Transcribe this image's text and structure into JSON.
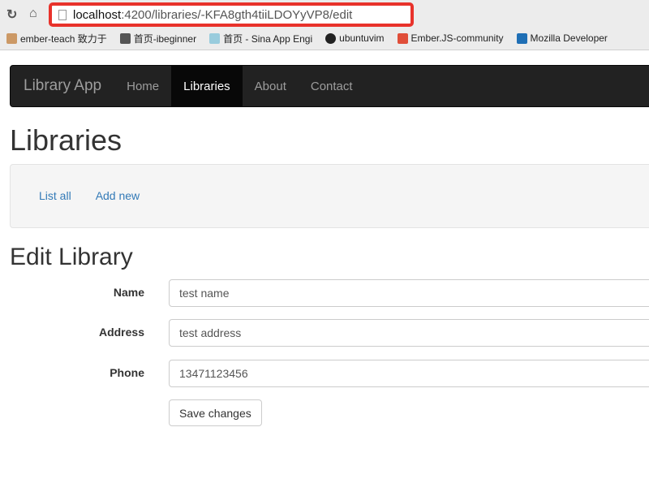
{
  "browser": {
    "url_host": "localhost",
    "url_rest": ":4200/libraries/-KFA8gth4tiiLDOYyVP8/edit",
    "bookmarks": [
      {
        "label": "ember-teach 致力于",
        "color": "#c96"
      },
      {
        "label": "首页-ibeginner",
        "color": "#555"
      },
      {
        "label": "首页 - Sina App Engi",
        "color": "#9cd"
      },
      {
        "label": "ubuntuvim",
        "color": "#222"
      },
      {
        "label": "Ember.JS-community",
        "color": "#e04e39"
      },
      {
        "label": "Mozilla Developer",
        "color": "#1f6fb5"
      }
    ]
  },
  "navbar": {
    "brand": "Library App",
    "items": [
      {
        "label": "Home"
      },
      {
        "label": "Libraries",
        "active": true
      },
      {
        "label": "About"
      },
      {
        "label": "Contact"
      }
    ]
  },
  "page": {
    "title": "Libraries",
    "links": [
      "List all",
      "Add new"
    ]
  },
  "form": {
    "title": "Edit Library",
    "fields": [
      {
        "label": "Name",
        "value": "test name"
      },
      {
        "label": "Address",
        "value": "test address"
      },
      {
        "label": "Phone",
        "value": "13471123456"
      }
    ],
    "save_label": "Save changes"
  }
}
